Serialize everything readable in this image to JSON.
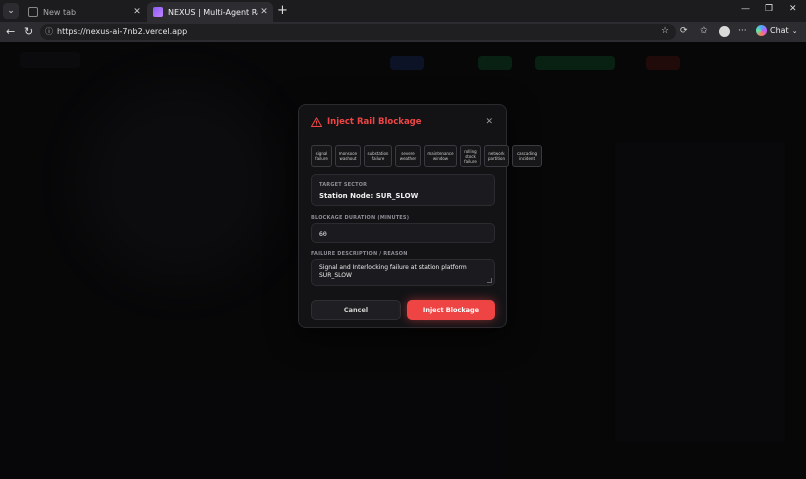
{
  "browser": {
    "tabs": [
      {
        "label": "New tab",
        "active": false
      },
      {
        "label": "NEXUS | Multi-Agent Rail Network",
        "active": true
      }
    ],
    "url": "https://nexus-ai-7nb2.vercel.app",
    "chat_label": "Chat"
  },
  "modal": {
    "title": "Inject Rail Blockage",
    "presets": [
      "signal failure",
      "monsoon washout",
      "substation failure",
      "severe weather",
      "maintenance window",
      "rolling stock failure",
      "network partition",
      "cascading incident"
    ],
    "target_sector_label": "TARGET SECTOR",
    "target_sector_value": "Station Node: SUR_SLOW",
    "duration_label": "BLOCKAGE DURATION (MINUTES)",
    "duration_value": "60",
    "description_label": "FAILURE DESCRIPTION / REASON",
    "description_value": "Signal and Interlocking failure at station platform SUR_SLOW",
    "cancel_label": "Cancel",
    "inject_label": "Inject Blockage"
  },
  "colors": {
    "accent": "#ef4444",
    "modal_bg": "#131316"
  }
}
